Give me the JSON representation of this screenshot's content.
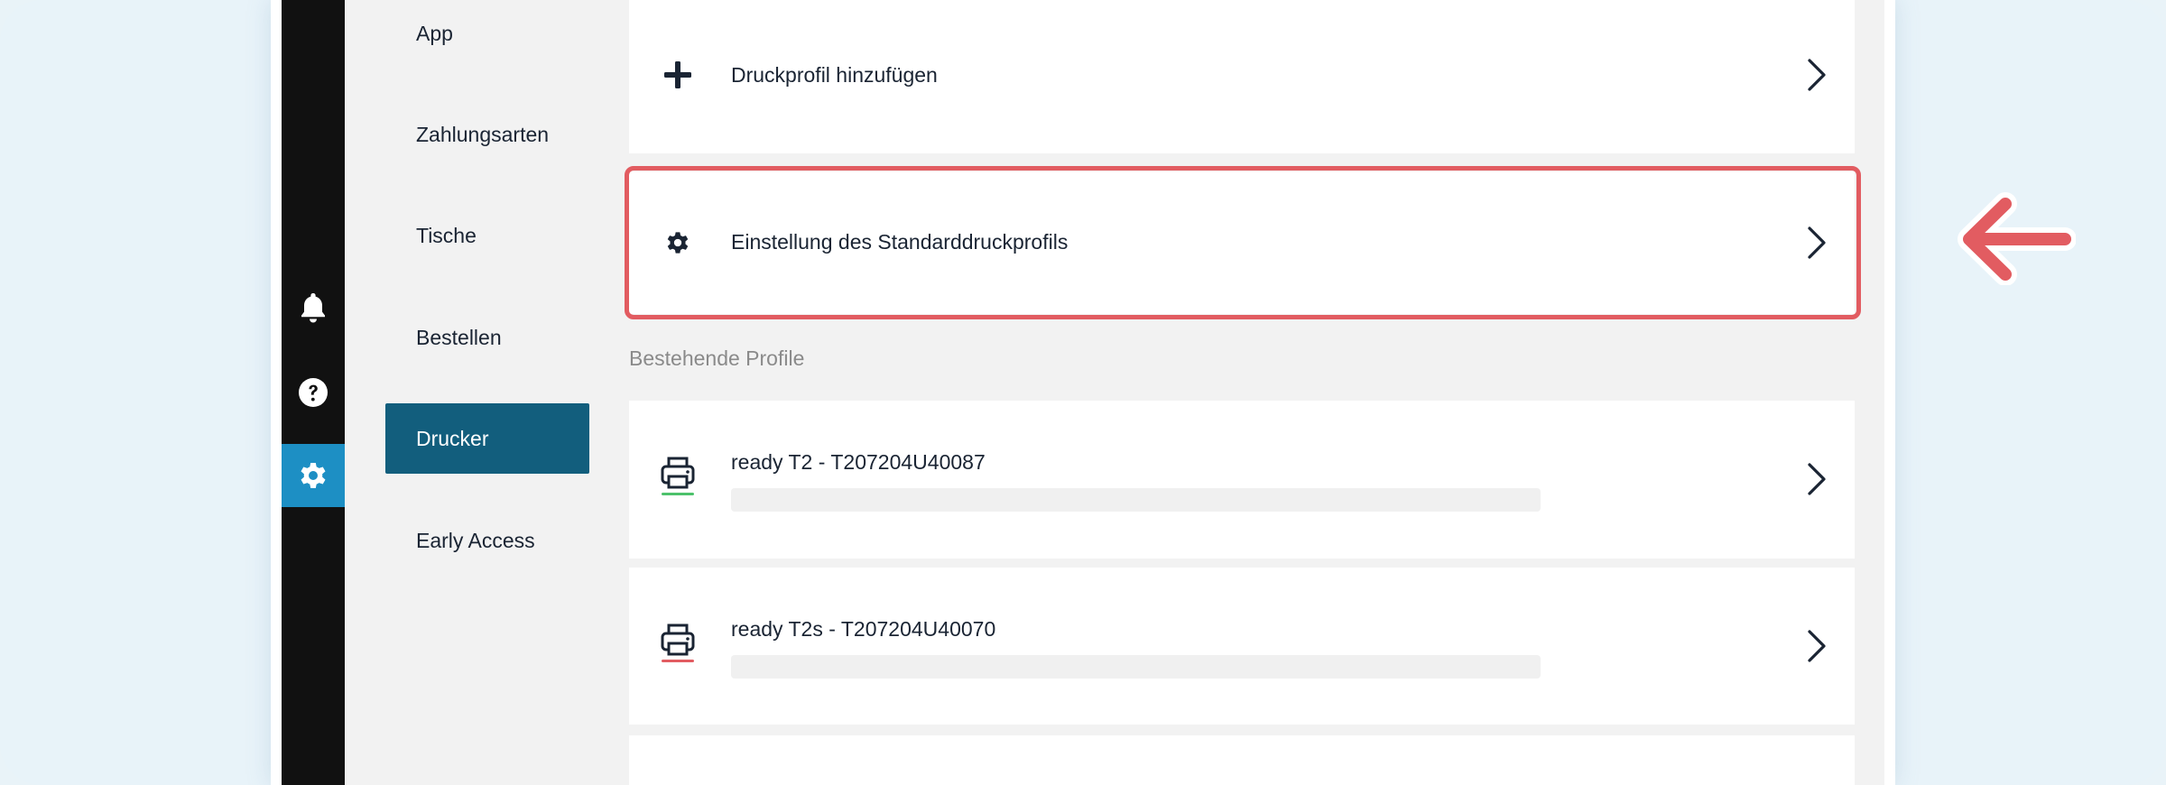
{
  "nav": {
    "items": [
      {
        "label": "App",
        "active": false
      },
      {
        "label": "Zahlungsarten",
        "active": false
      },
      {
        "label": "Tische",
        "active": false
      },
      {
        "label": "Bestellen",
        "active": false
      },
      {
        "label": "Drucker",
        "active": true
      },
      {
        "label": "Early Access",
        "active": false
      }
    ]
  },
  "rail": {
    "icons": [
      "bell-icon",
      "help-icon",
      "gear-icon"
    ],
    "active": "gear-icon"
  },
  "main": {
    "add_profile": {
      "label": "Druckprofil hinzufügen",
      "icon": "plus-icon"
    },
    "default_profile": {
      "label": "Einstellung des Standarddruckprofils",
      "icon": "gear-icon"
    },
    "section_title": "Bestehende Profile",
    "profiles": [
      {
        "label": "ready T2 - T207204U40087",
        "icon": "printer-icon",
        "status_color": "#4cc26b"
      },
      {
        "label": "ready T2s - T207204U40070",
        "icon": "printer-icon",
        "status_color": "#e25c61"
      }
    ]
  },
  "annotation": {
    "color": "#e25c61",
    "icon": "arrow-left-icon"
  }
}
